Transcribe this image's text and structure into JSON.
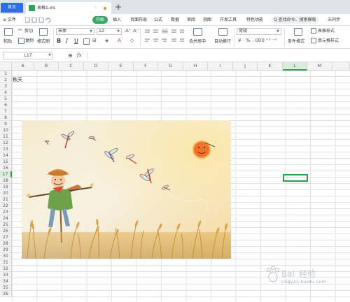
{
  "titlebar": {
    "home_tab": "首页",
    "file_tab": "表格1.xls",
    "add_tab": "+"
  },
  "menu": {
    "file": "≡ 文件",
    "items": [
      "开始",
      "插入",
      "页面布局",
      "公式",
      "数据",
      "审阅",
      "视图",
      "开发工具",
      "特色功能"
    ],
    "search": "Q 查找命令、搜索模板",
    "sync": "未同步"
  },
  "toolbar": {
    "paste": "粘贴",
    "cut": "剪切",
    "copy": "复制",
    "format_painter": "格式刷",
    "font_name": "宋体",
    "font_size": "12",
    "bold": "B",
    "italic": "I",
    "underline": "U",
    "merge_center": "合并居中",
    "wrap_text": "自动换行",
    "number_format": "常规",
    "conditional_format": "条件格式",
    "table_style": "表格样式",
    "cell_style": "单元格样式"
  },
  "formula_bar": {
    "name_box": "L17",
    "fx": "fx",
    "formula": ""
  },
  "sheet": {
    "columns": [
      "A",
      "B",
      "C",
      "D",
      "E",
      "F",
      "G",
      "H",
      "I",
      "J",
      "K",
      "L",
      "M"
    ],
    "rows": [
      "1",
      "2",
      "3",
      "4",
      "5",
      "6",
      "7",
      "8",
      "9",
      "10",
      "11",
      "12",
      "13",
      "14",
      "15",
      "16",
      "17",
      "18",
      "19",
      "20",
      "21",
      "22",
      "23",
      "24",
      "25",
      "26",
      "27",
      "28",
      "29",
      "30",
      "31",
      "32",
      "33",
      "34",
      "35",
      "36"
    ],
    "active_column": "L",
    "active_row": "17",
    "cell_a2": "秋天"
  },
  "watermark": {
    "text": "jingyan.baidu.com"
  },
  "colors": {
    "accent_green": "#3aa564",
    "home_tab_blue": "#2f6ee8",
    "selection_green": "#2d9c4f"
  }
}
